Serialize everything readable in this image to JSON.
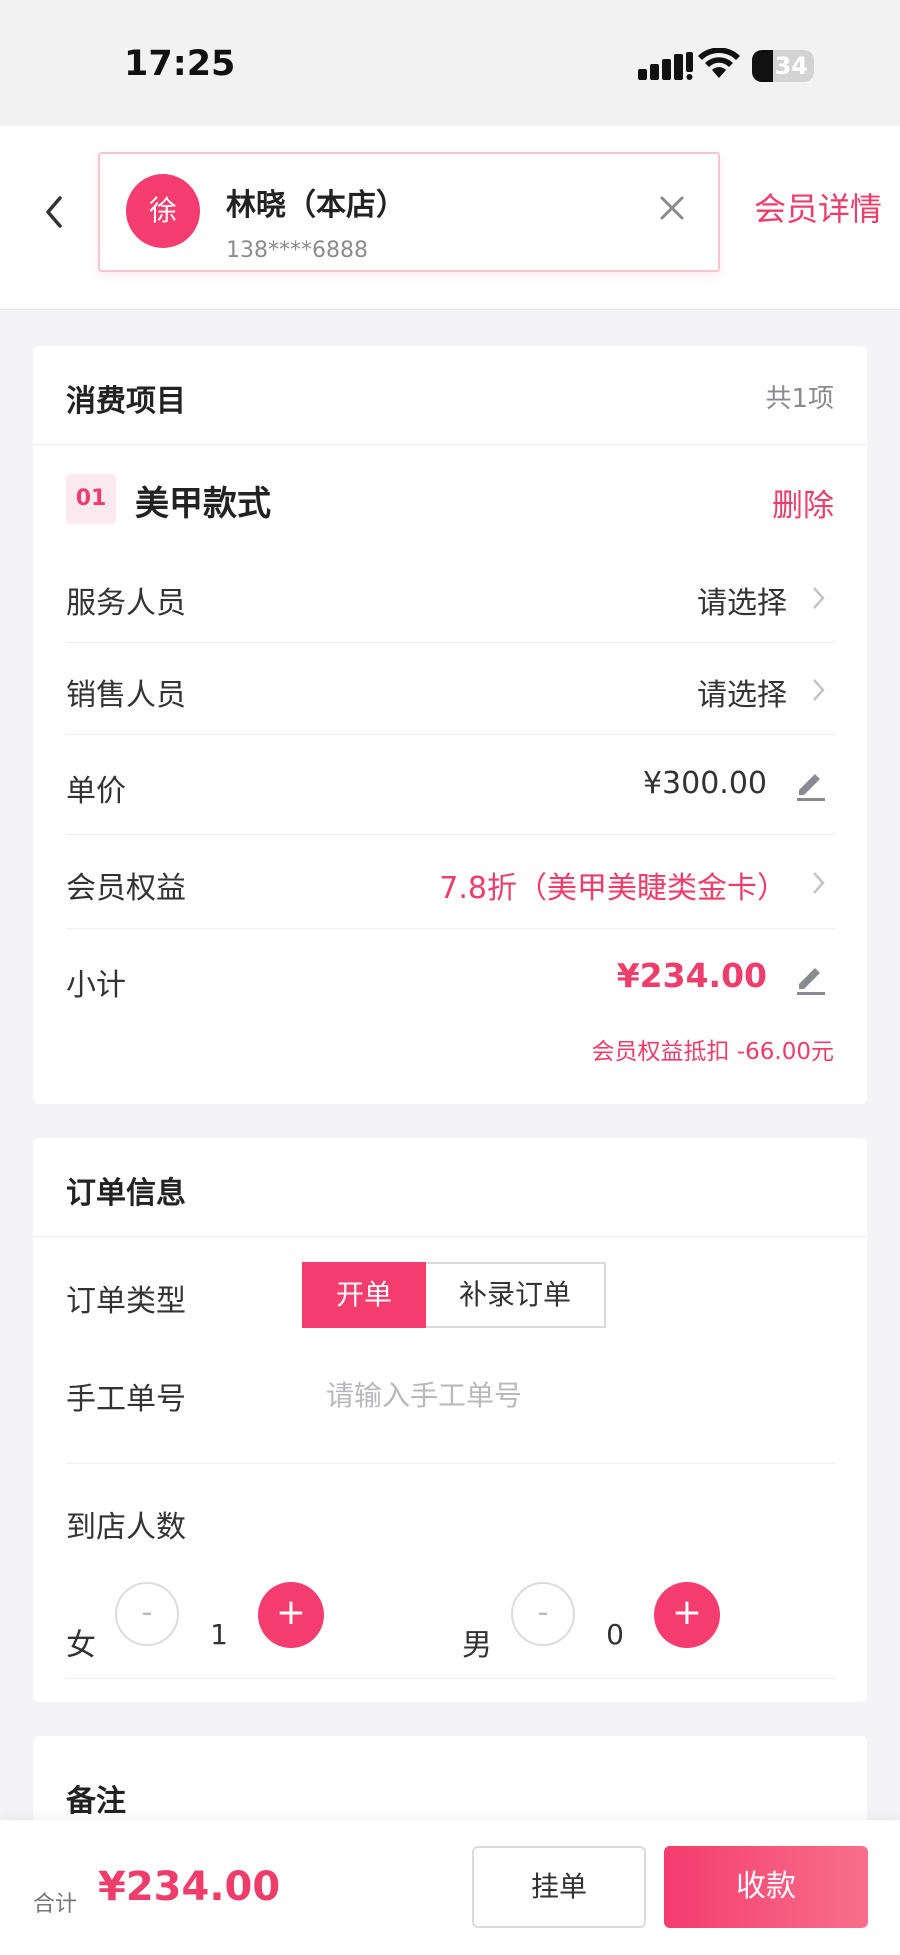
{
  "status_bar": {
    "time": "17:25",
    "battery": "34",
    "battery_level_percent": 34
  },
  "header": {
    "member_avatar_char": "徐",
    "member_name": "林晓（本店）",
    "member_phone": "138****6888",
    "detail_link": "会员详情"
  },
  "items_section": {
    "title": "消费项目",
    "count": "共1项",
    "item": {
      "index": "01",
      "name": "美甲款式",
      "delete_label": "删除",
      "rows": {
        "service_staff": {
          "label": "服务人员",
          "value": "请选择"
        },
        "sales_staff": {
          "label": "销售人员",
          "value": "请选择"
        },
        "unit_price": {
          "label": "单价",
          "value": "¥300.00"
        },
        "member_benefit": {
          "label": "会员权益",
          "value": "7.8折（美甲美睫类金卡）"
        },
        "subtotal": {
          "label": "小计",
          "value": "¥234.00"
        }
      },
      "discount_note": "会员权益抵扣 -66.00元"
    }
  },
  "order_section": {
    "title": "订单信息",
    "order_type": {
      "label": "订单类型",
      "options": [
        "开单",
        "补录订单"
      ],
      "selected": "开单"
    },
    "manual_no": {
      "label": "手工单号",
      "placeholder": "请输入手工单号"
    },
    "visitors": {
      "label": "到店人数",
      "female": {
        "label": "女",
        "count": "1"
      },
      "male": {
        "label": "男",
        "count": "0"
      },
      "minus": "-",
      "plus": "+"
    }
  },
  "remark_section": {
    "title": "备注"
  },
  "bottom_bar": {
    "total_label": "合计",
    "total_value": "¥234.00",
    "hold_button": "挂单",
    "pay_button": "收款"
  },
  "colors": {
    "accent": "#f43c6e",
    "accent_text": "#ef3d6b",
    "background": "#f4f4f6"
  }
}
